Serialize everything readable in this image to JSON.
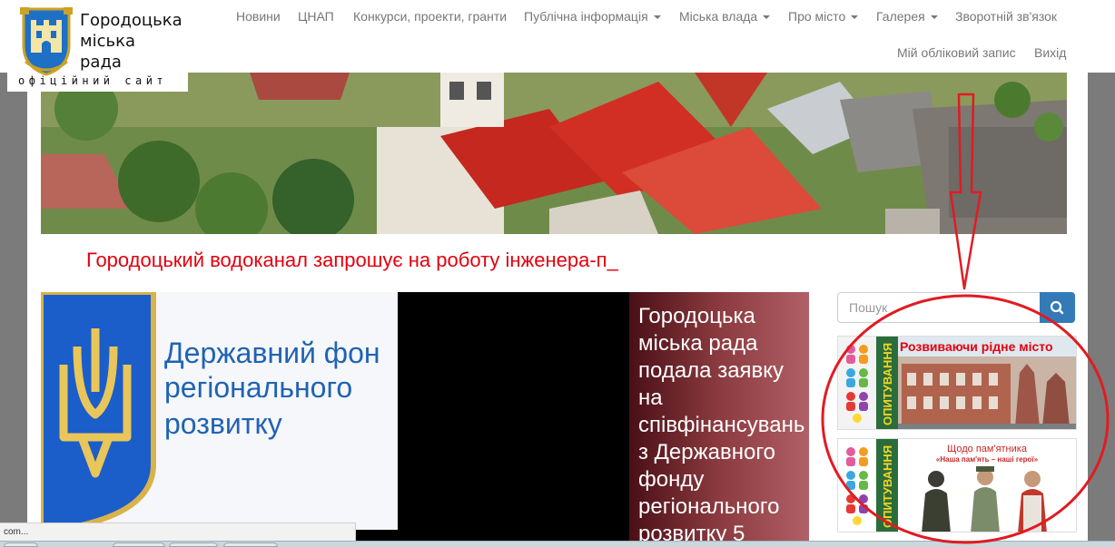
{
  "logo": {
    "name_line1": "Городоцька",
    "name_line2": "міська",
    "name_line3": "рада",
    "subtitle": "офіційний сайт",
    "icon": "coat-of-arms-icon"
  },
  "nav": {
    "items": [
      {
        "label": "Новини"
      },
      {
        "label": "ЦНАП"
      },
      {
        "label": "Конкурси, проекти, гранти"
      },
      {
        "label": "Публічна інформація"
      },
      {
        "label": "Міська влада"
      },
      {
        "label": "Про місто"
      },
      {
        "label": "Галерея"
      },
      {
        "label": "Зворотній зв'язок"
      }
    ],
    "account": "Мій обліковий запис",
    "logout": "Вихід"
  },
  "ticker": {
    "text": "Городоцький водоканал запрошує на роботу інженера-п_"
  },
  "slider": {
    "image_title_line1": "Державний фон",
    "image_title_line2": "регіонального",
    "image_title_line3": "розвитку",
    "caption_lines": [
      "Городоцька",
      "міська рада",
      "подала заявку",
      "на",
      "співфінансувань",
      "з Державного",
      "фонду",
      "регіонального",
      "розвитку 5"
    ]
  },
  "search": {
    "placeholder": "Пошук",
    "icon": "search-icon"
  },
  "polls": [
    {
      "vertical_label": "ОПИТУВАННЯ",
      "title": "Розвиваючи рідне місто"
    },
    {
      "vertical_label": "ОПИТУВАННЯ",
      "title": "Щодо пам'ятника",
      "subtitle": "«Наша пам'ять – наші герої»"
    }
  ],
  "status_bar": {
    "text": "com..."
  },
  "colors": {
    "ticker": "#e3000f",
    "search_button": "#337ab7",
    "annotation": "#e11b22",
    "caption_panel": "#8b3b3f"
  }
}
